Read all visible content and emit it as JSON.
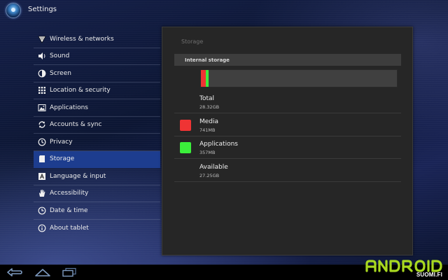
{
  "app": {
    "title": "Settings"
  },
  "sidebar": {
    "items": [
      {
        "label": "Wireless & networks",
        "icon": "wifi-icon",
        "active": false
      },
      {
        "label": "Sound",
        "icon": "speaker-icon",
        "active": false
      },
      {
        "label": "Screen",
        "icon": "brightness-icon",
        "active": false
      },
      {
        "label": "Location & security",
        "icon": "grid-icon",
        "active": false
      },
      {
        "label": "Applications",
        "icon": "apps-icon",
        "active": false
      },
      {
        "label": "Accounts & sync",
        "icon": "sync-icon",
        "active": false
      },
      {
        "label": "Privacy",
        "icon": "privacy-icon",
        "active": false
      },
      {
        "label": "Storage",
        "icon": "sdcard-icon",
        "active": true
      },
      {
        "label": "Language & input",
        "icon": "language-icon",
        "active": false
      },
      {
        "label": "Accessibility",
        "icon": "hand-icon",
        "active": false
      },
      {
        "label": "Date & time",
        "icon": "clock-icon",
        "active": false
      },
      {
        "label": "About tablet",
        "icon": "info-icon",
        "active": false
      }
    ]
  },
  "storage": {
    "panel_title": "Storage",
    "section_header": "Internal storage",
    "rows": [
      {
        "label": "Total",
        "value": "28.32GB",
        "swatch": null
      },
      {
        "label": "Media",
        "value": "741MB",
        "swatch": "#ef3434"
      },
      {
        "label": "Applications",
        "value": "357MB",
        "swatch": "#3bef3b"
      },
      {
        "label": "Available",
        "value": "27.25GB",
        "swatch": null
      }
    ],
    "usage_bar": {
      "segments": [
        {
          "name": "Media",
          "fraction": 0.0256,
          "color": "#ef3434"
        },
        {
          "name": "Applications",
          "fraction": 0.0123,
          "color": "#3bef3b"
        }
      ],
      "empty_color": "#404040"
    }
  },
  "navbar": {
    "buttons": [
      {
        "name": "back-button",
        "icon": "back-icon"
      },
      {
        "name": "home-button",
        "icon": "home-icon"
      },
      {
        "name": "recent-apps-button",
        "icon": "recent-apps-icon"
      }
    ]
  },
  "watermark": {
    "logo": "ANDROID",
    "text": "SUOMI.FI",
    "color": "#a8d820"
  }
}
